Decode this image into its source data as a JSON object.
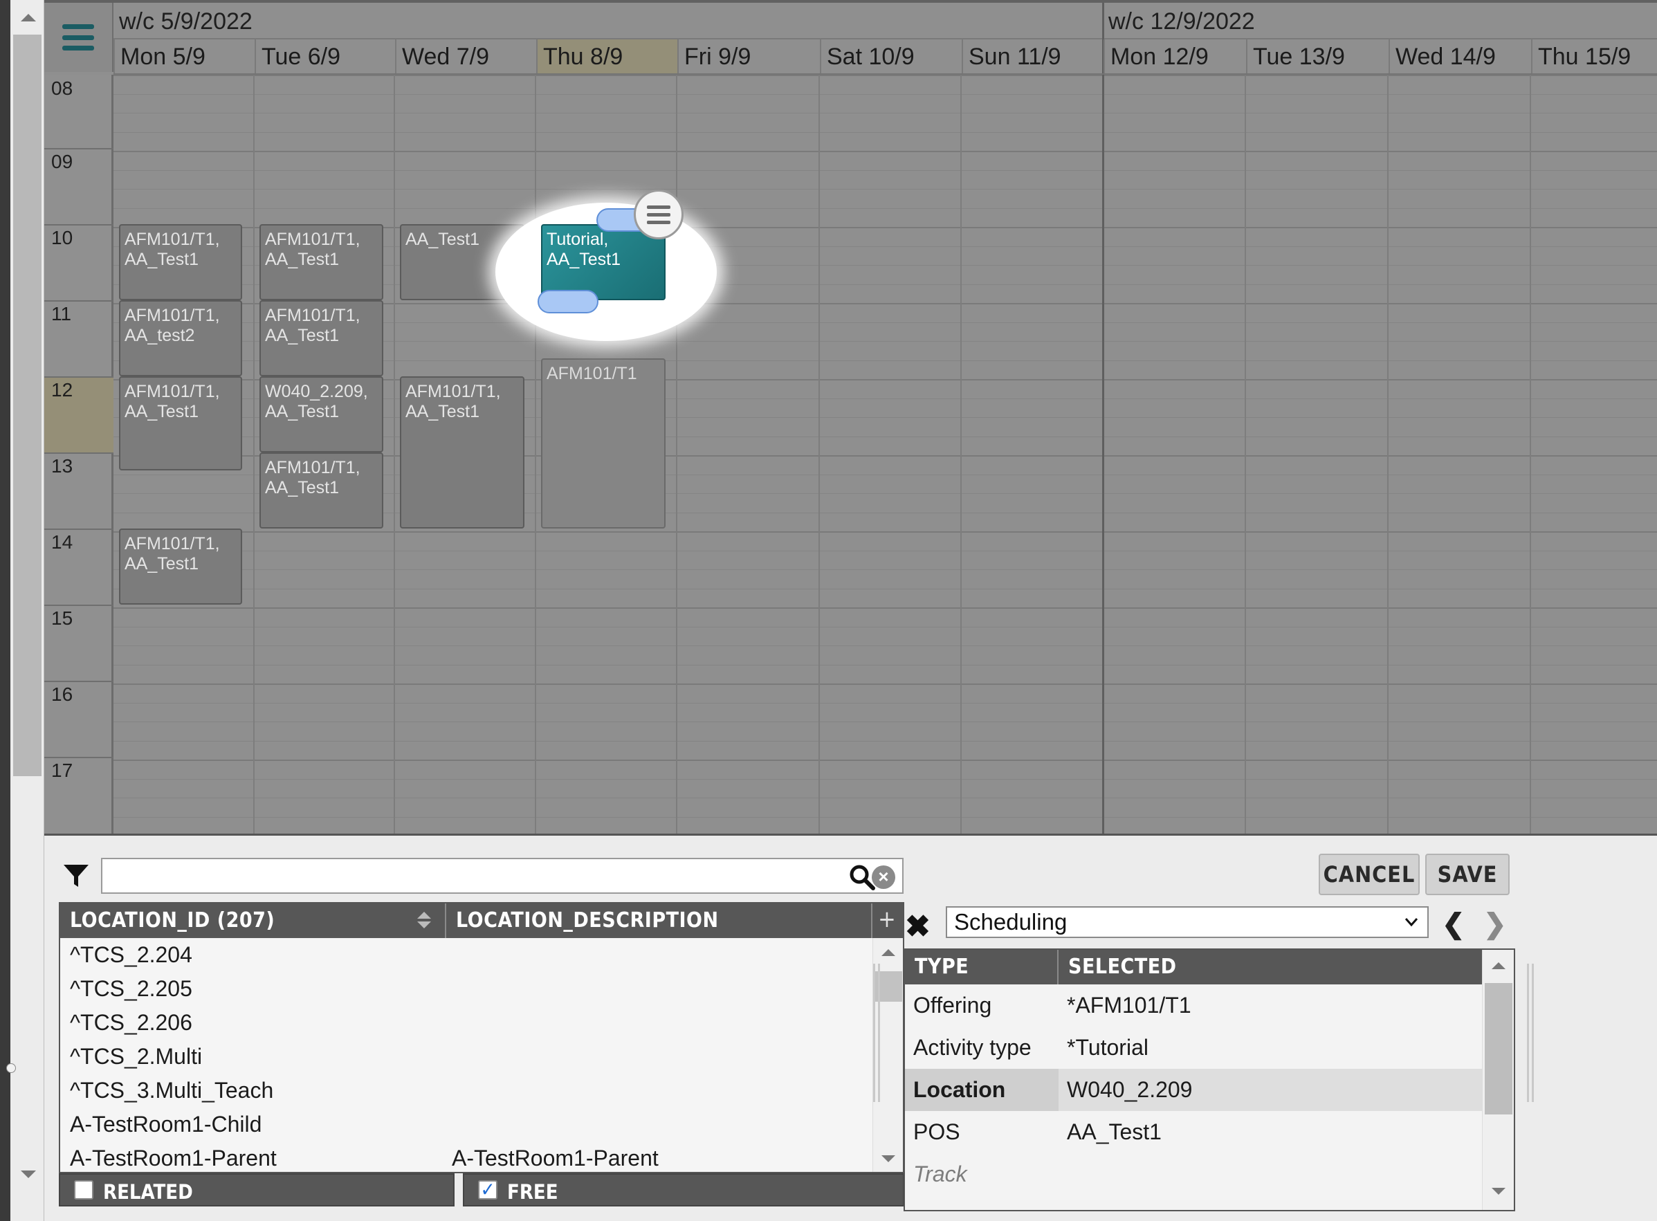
{
  "calendar": {
    "weeks": [
      {
        "label": "w/c 5/9/2022"
      },
      {
        "label": "w/c 12/9/2022"
      }
    ],
    "days": [
      {
        "label": "Mon 5/9"
      },
      {
        "label": "Tue 6/9"
      },
      {
        "label": "Wed 7/9"
      },
      {
        "label": "Thu 8/9",
        "today": true
      },
      {
        "label": "Fri 9/9"
      },
      {
        "label": "Sat 10/9"
      },
      {
        "label": "Sun 11/9"
      },
      {
        "label": "Mon 12/9"
      },
      {
        "label": "Tue 13/9"
      },
      {
        "label": "Wed 14/9"
      },
      {
        "label": "Thu 15/9"
      }
    ],
    "hours": [
      "08",
      "09",
      "10",
      "11",
      "12",
      "13",
      "14",
      "15",
      "16",
      "17"
    ],
    "current_hour": "12",
    "events": [
      {
        "line1": "AFM101/T1,",
        "line2": "AA_Test1"
      },
      {
        "line1": "AFM101/T1,",
        "line2": "AA_test2"
      },
      {
        "line1": "AFM101/T1,",
        "line2": "AA_Test1"
      },
      {
        "line1": "AFM101/T1,",
        "line2": "AA_Test1"
      },
      {
        "line1": "AFM101/T1,",
        "line2": "AA_Test1"
      },
      {
        "line1": "AFM101/T1,",
        "line2": "AA_Test1"
      },
      {
        "line1": "W040_2.209,",
        "line2": "AA_Test1"
      },
      {
        "line1": "AFM101/T1,",
        "line2": "AA_Test1"
      },
      {
        "line1": "AA_Test1",
        "line2": ""
      },
      {
        "line1": "AFM101/T1,",
        "line2": "AA_Test1"
      },
      {
        "line1": "AFM101/T1",
        "line2": ""
      }
    ],
    "active_event": {
      "line1": "Tutorial,",
      "line2": "AA_Test1"
    }
  },
  "search": {
    "value": "",
    "placeholder": ""
  },
  "location_table": {
    "col1_header": "LOCATION_ID (207)",
    "col2_header": "LOCATION_DESCRIPTION",
    "add_label": "+",
    "rows": [
      {
        "id": "^TCS_2.204",
        "desc": ""
      },
      {
        "id": "^TCS_2.205",
        "desc": ""
      },
      {
        "id": "^TCS_2.206",
        "desc": ""
      },
      {
        "id": "^TCS_2.Multi",
        "desc": ""
      },
      {
        "id": "^TCS_3.Multi_Teach",
        "desc": ""
      },
      {
        "id": "A-TestRoom1-Child",
        "desc": ""
      },
      {
        "id": "A-TestRoom1-Parent",
        "desc": "A-TestRoom1-Parent"
      }
    ]
  },
  "toggles": {
    "related": {
      "label": "RELATED",
      "checked": false
    },
    "free": {
      "label": "FREE",
      "checked": true
    }
  },
  "buttons": {
    "cancel": "CANCEL",
    "save": "SAVE"
  },
  "mode_select": {
    "value": "Scheduling"
  },
  "type_table": {
    "col1_header": "TYPE",
    "col2_header": "SELECTED",
    "rows": [
      {
        "type": "Offering",
        "selected": "*AFM101/T1"
      },
      {
        "type": "Activity type",
        "selected": "*Tutorial"
      },
      {
        "type": "Location",
        "selected": "W040_2.209",
        "highlighted": true
      },
      {
        "type": "POS",
        "selected": "AA_Test1"
      },
      {
        "type": "Track",
        "selected": ""
      }
    ]
  },
  "colors": {
    "accent": "#1f7f86",
    "today_header": "#948f78",
    "handle": "#a9c8f5"
  }
}
